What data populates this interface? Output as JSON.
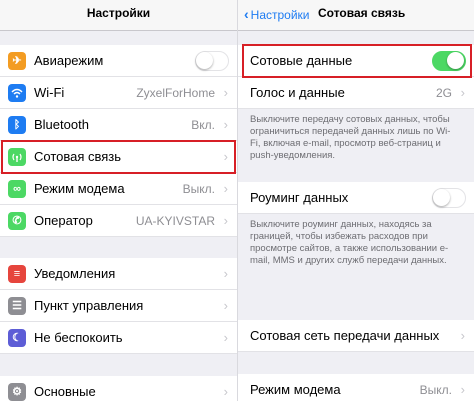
{
  "left": {
    "title": "Настройки",
    "rows": [
      {
        "label": "Авиарежим",
        "icon": "airplane-icon",
        "icon_color": "#f39c22",
        "toggle": false
      },
      {
        "label": "Wi-Fi",
        "value": "ZyxelForHome",
        "icon": "wifi-icon",
        "icon_color": "#1e7cf2"
      },
      {
        "label": "Bluetooth",
        "value": "Вкл.",
        "icon": "bluetooth-icon",
        "icon_color": "#1e7cf2"
      },
      {
        "label": "Сотовая связь",
        "icon": "cellular-icon",
        "icon_color": "#4cd864"
      },
      {
        "label": "Режим модема",
        "value": "Выкл.",
        "icon": "hotspot-icon",
        "icon_color": "#4cd864"
      },
      {
        "label": "Оператор",
        "value": "UA-KYIVSTAR",
        "icon": "carrier-phone-icon",
        "icon_color": "#4cd864"
      },
      {
        "label": "Уведомления",
        "icon": "notifications-icon",
        "icon_color": "#e6453d"
      },
      {
        "label": "Пункт управления",
        "icon": "control-center-icon",
        "icon_color": "#8e8e93"
      },
      {
        "label": "Не беспокоить",
        "icon": "do-not-disturb-icon",
        "icon_color": "#5d5dd6"
      },
      {
        "label": "Основные",
        "icon": "gear-icon",
        "icon_color": "#8e8e93"
      }
    ]
  },
  "right": {
    "back_label": "Настройки",
    "title": "Сотовая связь",
    "cellular_data": {
      "label": "Сотовые данные",
      "toggle": true
    },
    "voice_data": {
      "label": "Голос и данные",
      "value": "2G"
    },
    "note1": "Выключите передачу сотовых данных, чтобы ограничиться передачей данных лишь по Wi-Fi, включая e-mail, просмотр веб-страниц и push-уведомления.",
    "roaming": {
      "label": "Роуминг данных",
      "toggle": false
    },
    "note2": "Выключите роуминг данных, находясь за границей, чтобы избежать расходов при просмотре сайтов, а также использовании e-mail, MMS и других служб передачи данных.",
    "cellular_network": {
      "label": "Сотовая сеть передачи данных"
    },
    "modem": {
      "label": "Режим модема",
      "value": "Выкл."
    }
  },
  "colors": {
    "highlight": "#d71f26",
    "accent": "#1e7cf2",
    "toggle_on": "#4cd864"
  }
}
